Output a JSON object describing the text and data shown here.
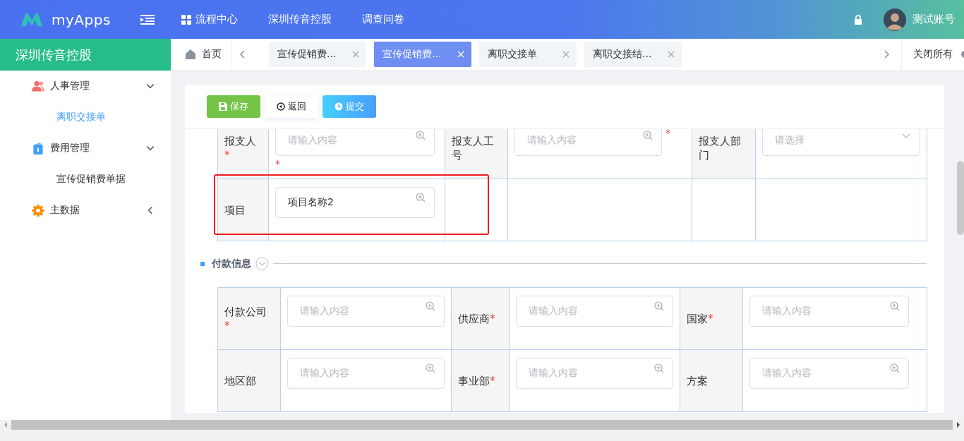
{
  "header": {
    "logo": "myApps",
    "nav": [
      {
        "label": "流程中心"
      },
      {
        "label": "深圳传音控股"
      },
      {
        "label": "调查问卷"
      }
    ],
    "user": "测试账号"
  },
  "sidebar": {
    "title": "深圳传音控股",
    "items": [
      {
        "label": "人事管理",
        "expanded": true,
        "children": [
          {
            "label": "离职交接单",
            "selected": true
          }
        ]
      },
      {
        "label": "费用管理",
        "expanded": true,
        "children": [
          {
            "label": "宣传促销费单据",
            "selected": false
          }
        ]
      },
      {
        "label": "主数据",
        "expanded": false
      }
    ]
  },
  "tabs": {
    "home": "首页",
    "items": [
      {
        "label": "宣传促销费...",
        "selected": false
      },
      {
        "label": "宣传促销费...",
        "selected": true
      },
      {
        "label": "离职交接单",
        "selected": false
      },
      {
        "label": "离职交接结...",
        "selected": false
      }
    ],
    "close_all": "关闭所有"
  },
  "toolbar": [
    {
      "label": "保存",
      "kind": "save"
    },
    {
      "label": "返回",
      "kind": "back"
    },
    {
      "label": "提交",
      "kind": "submit"
    }
  ],
  "form_top": {
    "rows": [
      [
        {
          "kind": "label",
          "text": "报支人",
          "mark": "*"
        },
        {
          "kind": "input",
          "placeholder": "请输入内容",
          "mark": "*"
        },
        {
          "kind": "label",
          "text": "报支人工号"
        },
        {
          "kind": "input",
          "placeholder": "请输入内容",
          "mark": "*"
        },
        {
          "kind": "label",
          "text": "报支人部门"
        },
        {
          "kind": "select",
          "placeholder": "请选择"
        }
      ],
      [
        {
          "kind": "label",
          "text": "项目"
        },
        {
          "kind": "input",
          "value": "项目名称2"
        },
        {
          "kind": "empty"
        },
        {
          "kind": "empty"
        },
        {
          "kind": "empty"
        },
        {
          "kind": "empty"
        }
      ]
    ]
  },
  "payment": {
    "title": "付款信息",
    "expanded": true,
    "rows": [
      [
        {
          "kind": "label",
          "text": "付款公司",
          "mark": "*"
        },
        {
          "kind": "input",
          "placeholder": "请输入内容"
        },
        {
          "kind": "label",
          "text": "供应商",
          "mark": "*"
        },
        {
          "kind": "input",
          "placeholder": "请输入内容"
        },
        {
          "kind": "label",
          "text": "国家",
          "mark": "*"
        },
        {
          "kind": "input",
          "placeholder": "请输入内容"
        }
      ],
      [
        {
          "kind": "label",
          "text": "地区部"
        },
        {
          "kind": "input",
          "placeholder": "请输入内容"
        },
        {
          "kind": "label",
          "text": "事业部",
          "mark": "*"
        },
        {
          "kind": "input",
          "placeholder": "请输入内容"
        },
        {
          "kind": "label",
          "text": "方案"
        },
        {
          "kind": "input",
          "placeholder": "请输入内容"
        }
      ]
    ]
  }
}
